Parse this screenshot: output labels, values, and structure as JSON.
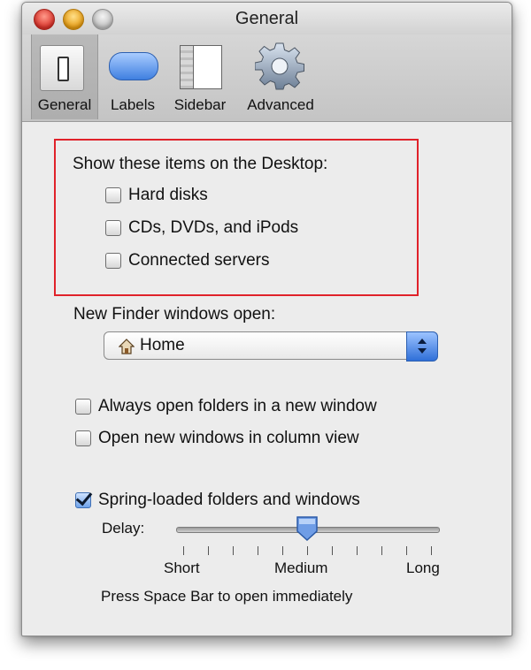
{
  "window": {
    "title": "General"
  },
  "toolbar": {
    "items": [
      {
        "label": "General",
        "icon": "switch-icon",
        "selected": true
      },
      {
        "label": "Labels",
        "icon": "label-pill-icon",
        "selected": false
      },
      {
        "label": "Sidebar",
        "icon": "sidebar-icon",
        "selected": false
      },
      {
        "label": "Advanced",
        "icon": "gear-icon",
        "selected": false
      }
    ]
  },
  "desktop_items": {
    "heading": "Show these items on the Desktop:",
    "options": [
      {
        "label": "Hard disks",
        "checked": false
      },
      {
        "label": "CDs, DVDs, and iPods",
        "checked": false
      },
      {
        "label": "Connected servers",
        "checked": false
      }
    ]
  },
  "new_window": {
    "label": "New Finder windows open:",
    "selected": "Home",
    "icon": "house-icon"
  },
  "folder_options": [
    {
      "label": "Always open folders in a new window",
      "checked": false
    },
    {
      "label": "Open new windows in column view",
      "checked": false
    }
  ],
  "spring_loaded": {
    "label": "Spring-loaded folders and windows",
    "checked": true,
    "delay_label": "Delay:",
    "ticks": [
      "Short",
      "Medium",
      "Long"
    ],
    "value": 0.5,
    "hint": "Press Space Bar to open immediately"
  },
  "colors": {
    "highlight_box": "#e0222a",
    "accent": "#3f7fe0"
  }
}
